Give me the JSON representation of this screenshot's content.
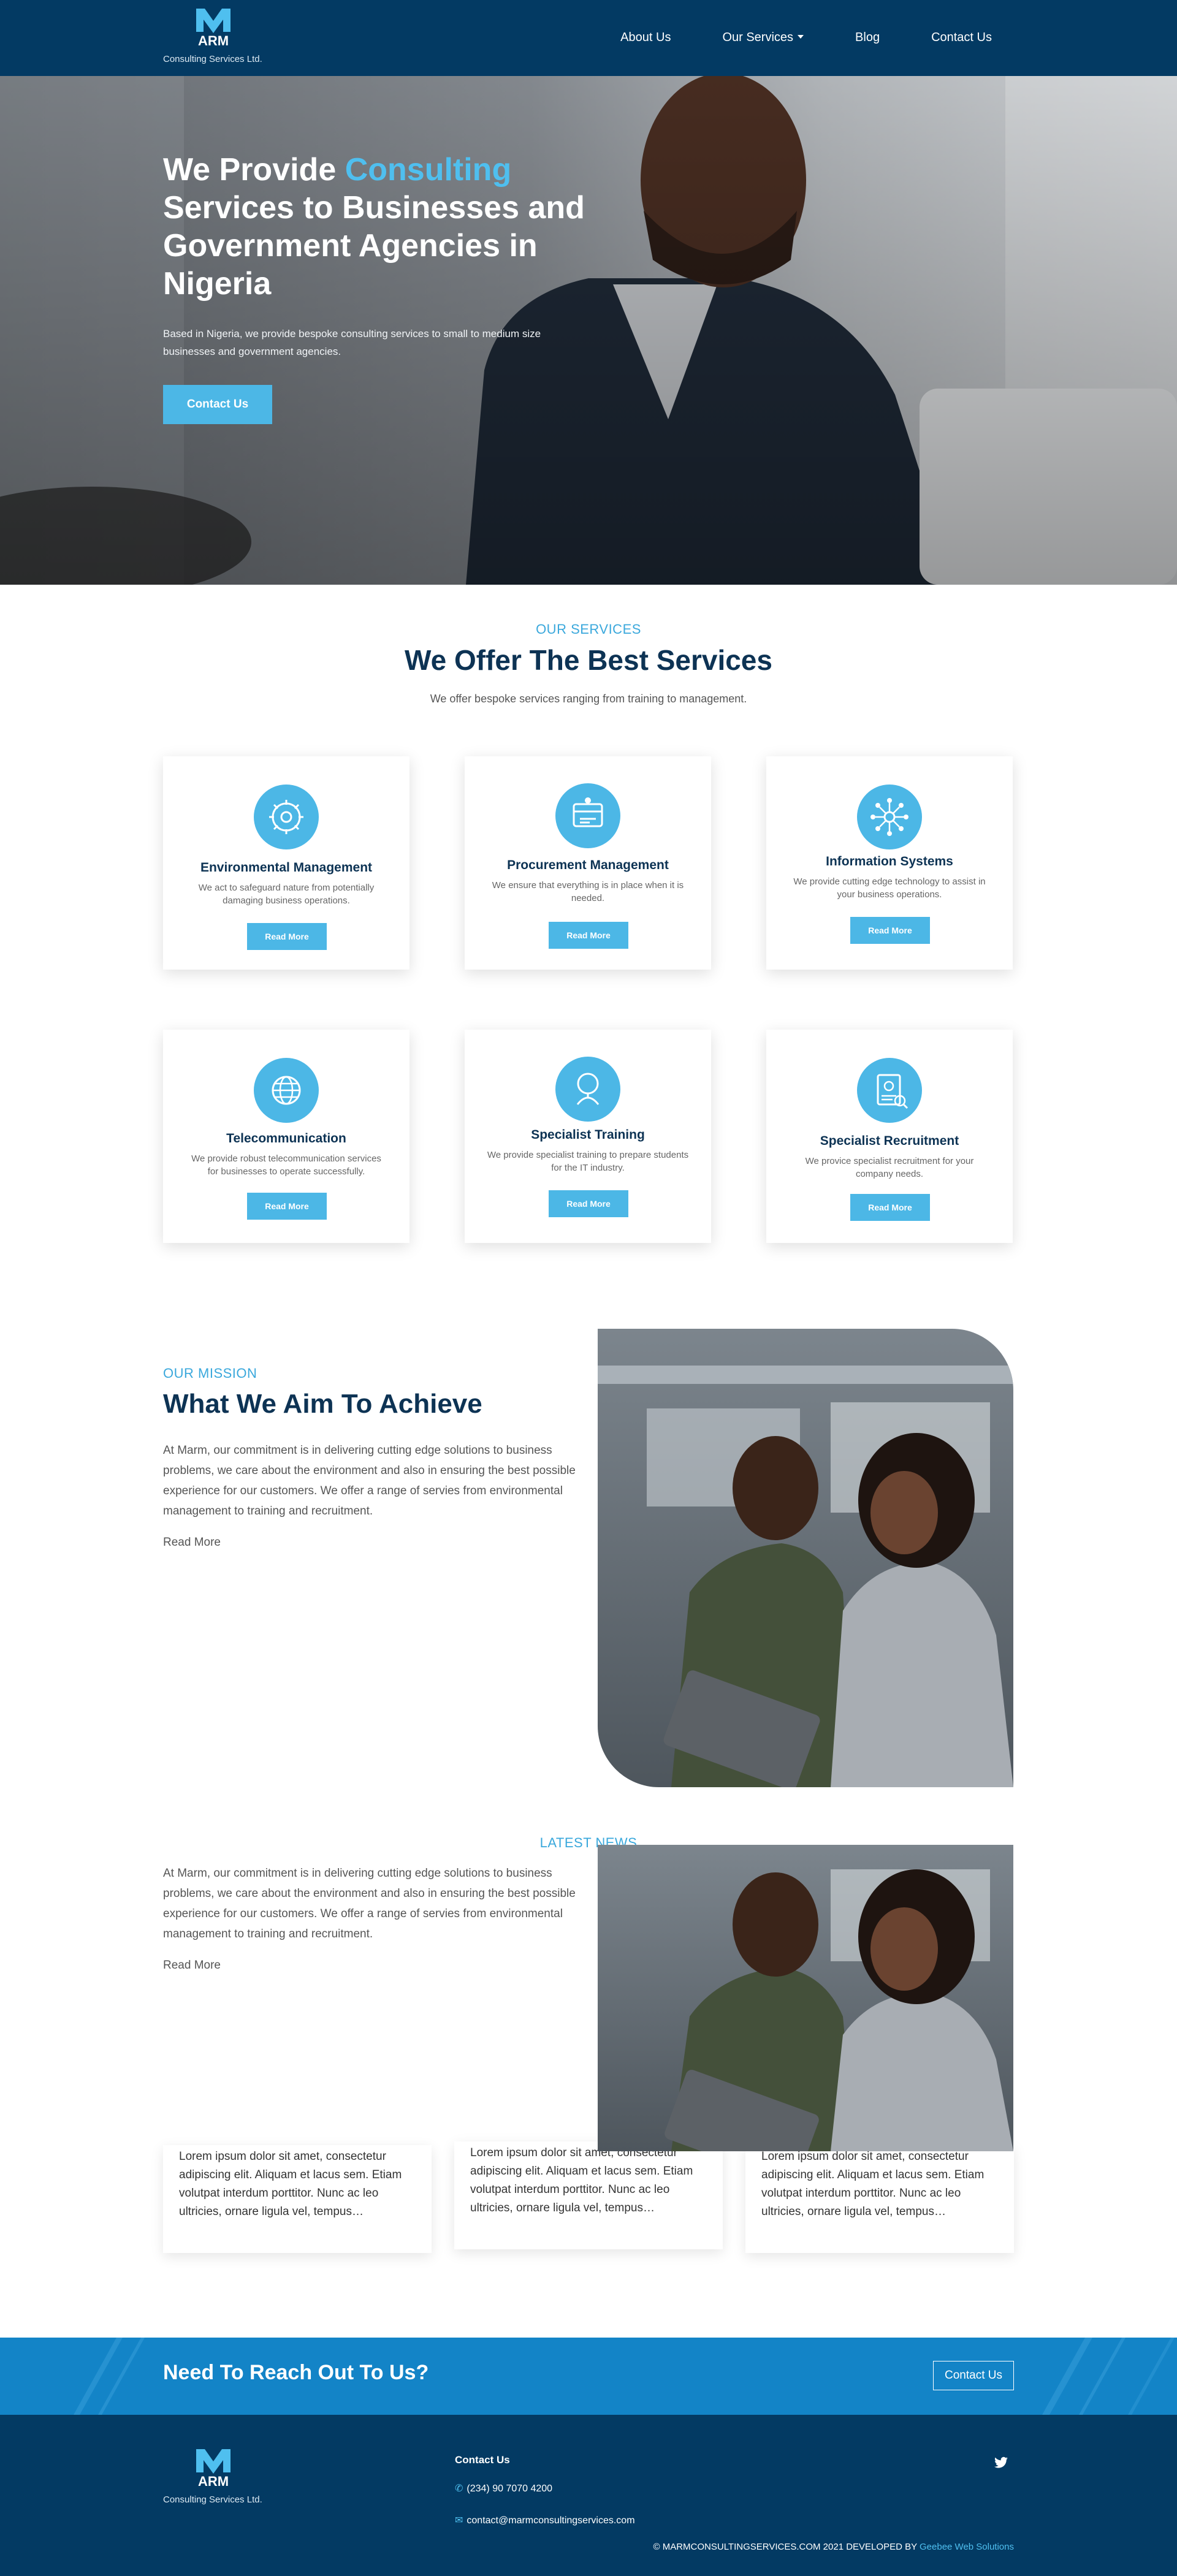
{
  "nav": {
    "logo_letters": "ARM",
    "logo_subtitle": "Consulting Services Ltd.",
    "links": [
      "About Us",
      "Our Services",
      "Blog",
      "Contact Us"
    ]
  },
  "hero": {
    "title_pre": "We Provide ",
    "title_accent": "Consulting",
    "title_post": " Services to Businesses and Government Agencies in Nigeria",
    "subtitle": "Based in Nigeria, we provide bespoke consulting services to small to medium size businesses and government agencies.",
    "button": "Contact Us"
  },
  "services": {
    "eyebrow": "OUR SERVICES",
    "title": "We Offer The Best Services",
    "subtitle": "We offer bespoke services ranging from training to management.",
    "cards": [
      {
        "title": "Environmental Management",
        "text": "We act to safeguard nature from potentially damaging business operations.",
        "button": "Read More",
        "icon": "gear-icon"
      },
      {
        "title": "Procurement Management",
        "text": "We ensure that everything is in place when it is needed.",
        "button": "Read More",
        "icon": "procurement-icon"
      },
      {
        "title": "Information Systems",
        "text": "We provide cutting edge technology to assist in your business operations.",
        "button": "Read More",
        "icon": "network-icon"
      },
      {
        "title": "Telecommunication",
        "text": "We provide robust telecommunication services for businesses to operate successfully.",
        "button": "Read More",
        "icon": "globe-icon"
      },
      {
        "title": "Specialist Training",
        "text": "We provide specialist training to prepare students for the IT industry.",
        "button": "Read More",
        "icon": "trainer-icon"
      },
      {
        "title": "Specialist Recruitment",
        "text": "We provice specialist recruitment for your company needs.",
        "button": "Read More",
        "icon": "resume-icon"
      }
    ]
  },
  "mission": {
    "eyebrow": "OUR MISSION",
    "title": "What We Aim To Achieve",
    "text": "At Marm, our commitment is in delivering cutting edge solutions to business problems, we care about the environment and also in ensuring the best possible experience for our customers. We offer a range of servies from environmental management to training and recruitment.",
    "read_more": "Read More"
  },
  "news": {
    "eyebrow": "LATEST NEWS",
    "excerpt": "Lorem ipsum dolor sit amet, consectetur adipiscing elit. Aliquam et lacus sem. Etiam volutpat interdum porttitor. Nunc ac leo ultricies, ornare ligula vel, tempus…"
  },
  "cta": {
    "title": "Need To Reach Out To Us?",
    "button": "Contact Us"
  },
  "footer": {
    "contact_heading": "Contact Us",
    "phone": "(234) 90 7070 4200",
    "email": "contact@marmconsultingservices.com",
    "copyright": "© MARMCONSULTINGSERVICES.COM 2021 DEVELOPED BY ",
    "developer": "Geebee Web Solutions"
  },
  "colors": {
    "navy": "#033a63",
    "accent": "#4cb7e6",
    "heading": "#0d3354",
    "cta_blue": "#1384c7"
  }
}
